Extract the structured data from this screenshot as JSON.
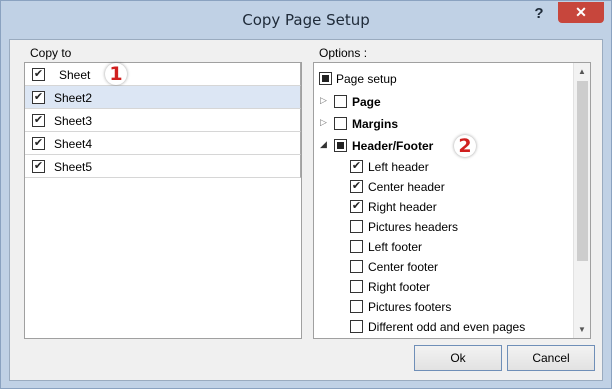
{
  "window": {
    "title": "Copy Page Setup",
    "help_label": "?",
    "close_label": "✕"
  },
  "copy_to": {
    "label": "Copy to",
    "sheets": [
      {
        "name": "Sheet",
        "checked": true,
        "selected": false
      },
      {
        "name": "Sheet2",
        "checked": true,
        "selected": true
      },
      {
        "name": "Sheet3",
        "checked": true,
        "selected": false
      },
      {
        "name": "Sheet4",
        "checked": true,
        "selected": false
      },
      {
        "name": "Sheet5",
        "checked": true,
        "selected": false
      }
    ],
    "marker": "1"
  },
  "options": {
    "label": "Options :",
    "root": {
      "label": "Page setup",
      "state": "partial"
    },
    "groups": [
      {
        "label": "Page",
        "state": "unchecked",
        "expanded": false
      },
      {
        "label": "Margins",
        "state": "unchecked",
        "expanded": false
      },
      {
        "label": "Header/Footer",
        "state": "partial",
        "expanded": true
      }
    ],
    "header_footer_items": [
      {
        "label": "Left header",
        "checked": true
      },
      {
        "label": "Center header",
        "checked": true
      },
      {
        "label": "Right header",
        "checked": true
      },
      {
        "label": "Pictures headers",
        "checked": false
      },
      {
        "label": "Left footer",
        "checked": false
      },
      {
        "label": "Center footer",
        "checked": false
      },
      {
        "label": "Right footer",
        "checked": false
      },
      {
        "label": "Pictures footers",
        "checked": false
      },
      {
        "label": "Different odd and even pages",
        "checked": false
      }
    ],
    "marker": "2",
    "expander_collapsed": "▷",
    "expander_expanded": "◢"
  },
  "buttons": {
    "ok": "Ok",
    "cancel": "Cancel"
  },
  "colors": {
    "title_bar": "#c0d1e5",
    "close_button": "#c7463c",
    "selection": "#dce6f4",
    "marker": "#d0201f"
  }
}
